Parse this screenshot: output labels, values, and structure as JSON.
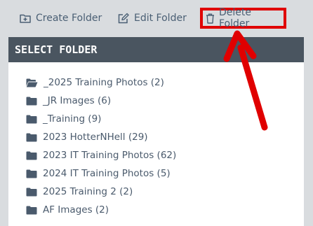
{
  "toolbar": {
    "create_label": "Create Folder",
    "edit_label": "Edit Folder",
    "delete_label": "Delete Folder"
  },
  "panel": {
    "title": "SELECT FOLDER"
  },
  "folders": [
    {
      "label": "_2025 Training Photos (2)",
      "icon": "folder-open-icon"
    },
    {
      "label": "_JR Images (6)",
      "icon": "folder-icon"
    },
    {
      "label": "_Training (9)",
      "icon": "folder-icon"
    },
    {
      "label": "2023 HotterNHell (29)",
      "icon": "folder-icon"
    },
    {
      "label": "2023 IT Training Photos (62)",
      "icon": "folder-icon"
    },
    {
      "label": "2024 IT Training Photos (5)",
      "icon": "folder-icon"
    },
    {
      "label": "2025 Training 2 (2)",
      "icon": "folder-icon"
    },
    {
      "label": "AF Images (2)",
      "icon": "folder-icon"
    }
  ],
  "colors": {
    "accent": "#e00000",
    "toolbar_text": "#4a5f74",
    "header_bg": "#4a5560",
    "folder_icon": "#4a5a6c"
  }
}
